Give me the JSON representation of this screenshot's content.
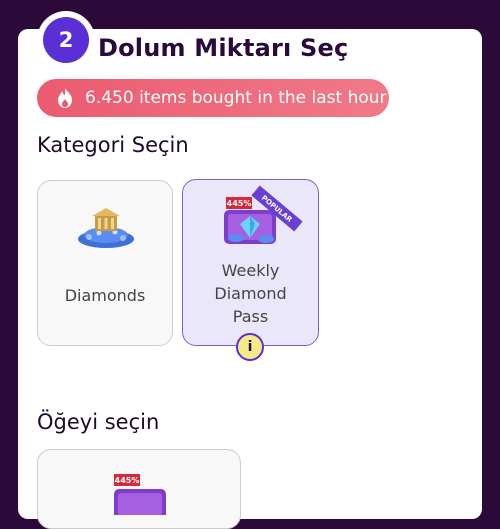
{
  "step": {
    "number": "2",
    "title": "Dolum Miktarı Seç"
  },
  "promo": {
    "text": "6.450 items bought in the last hour",
    "icon": "flame-icon"
  },
  "category_section": {
    "title": "Kategori Seçin"
  },
  "categories": [
    {
      "label": "Diamonds",
      "icon": "diamond-pile-icon",
      "selected": false
    },
    {
      "label": "Weekly Diamond Pass",
      "icon": "diamond-pass-icon",
      "selected": true,
      "discount_tag": "445%",
      "ribbon": "POPULAR"
    }
  ],
  "info_badge": {
    "label": "i"
  },
  "item_section": {
    "title": "Öğeyi seçin"
  },
  "items": [
    {
      "discount_tag": "445%",
      "icon": "diamond-pass-icon"
    }
  ],
  "colors": {
    "accent": "#5b2fd6",
    "promo": "#ec5a70",
    "page_bg": "#2b0a3a"
  }
}
